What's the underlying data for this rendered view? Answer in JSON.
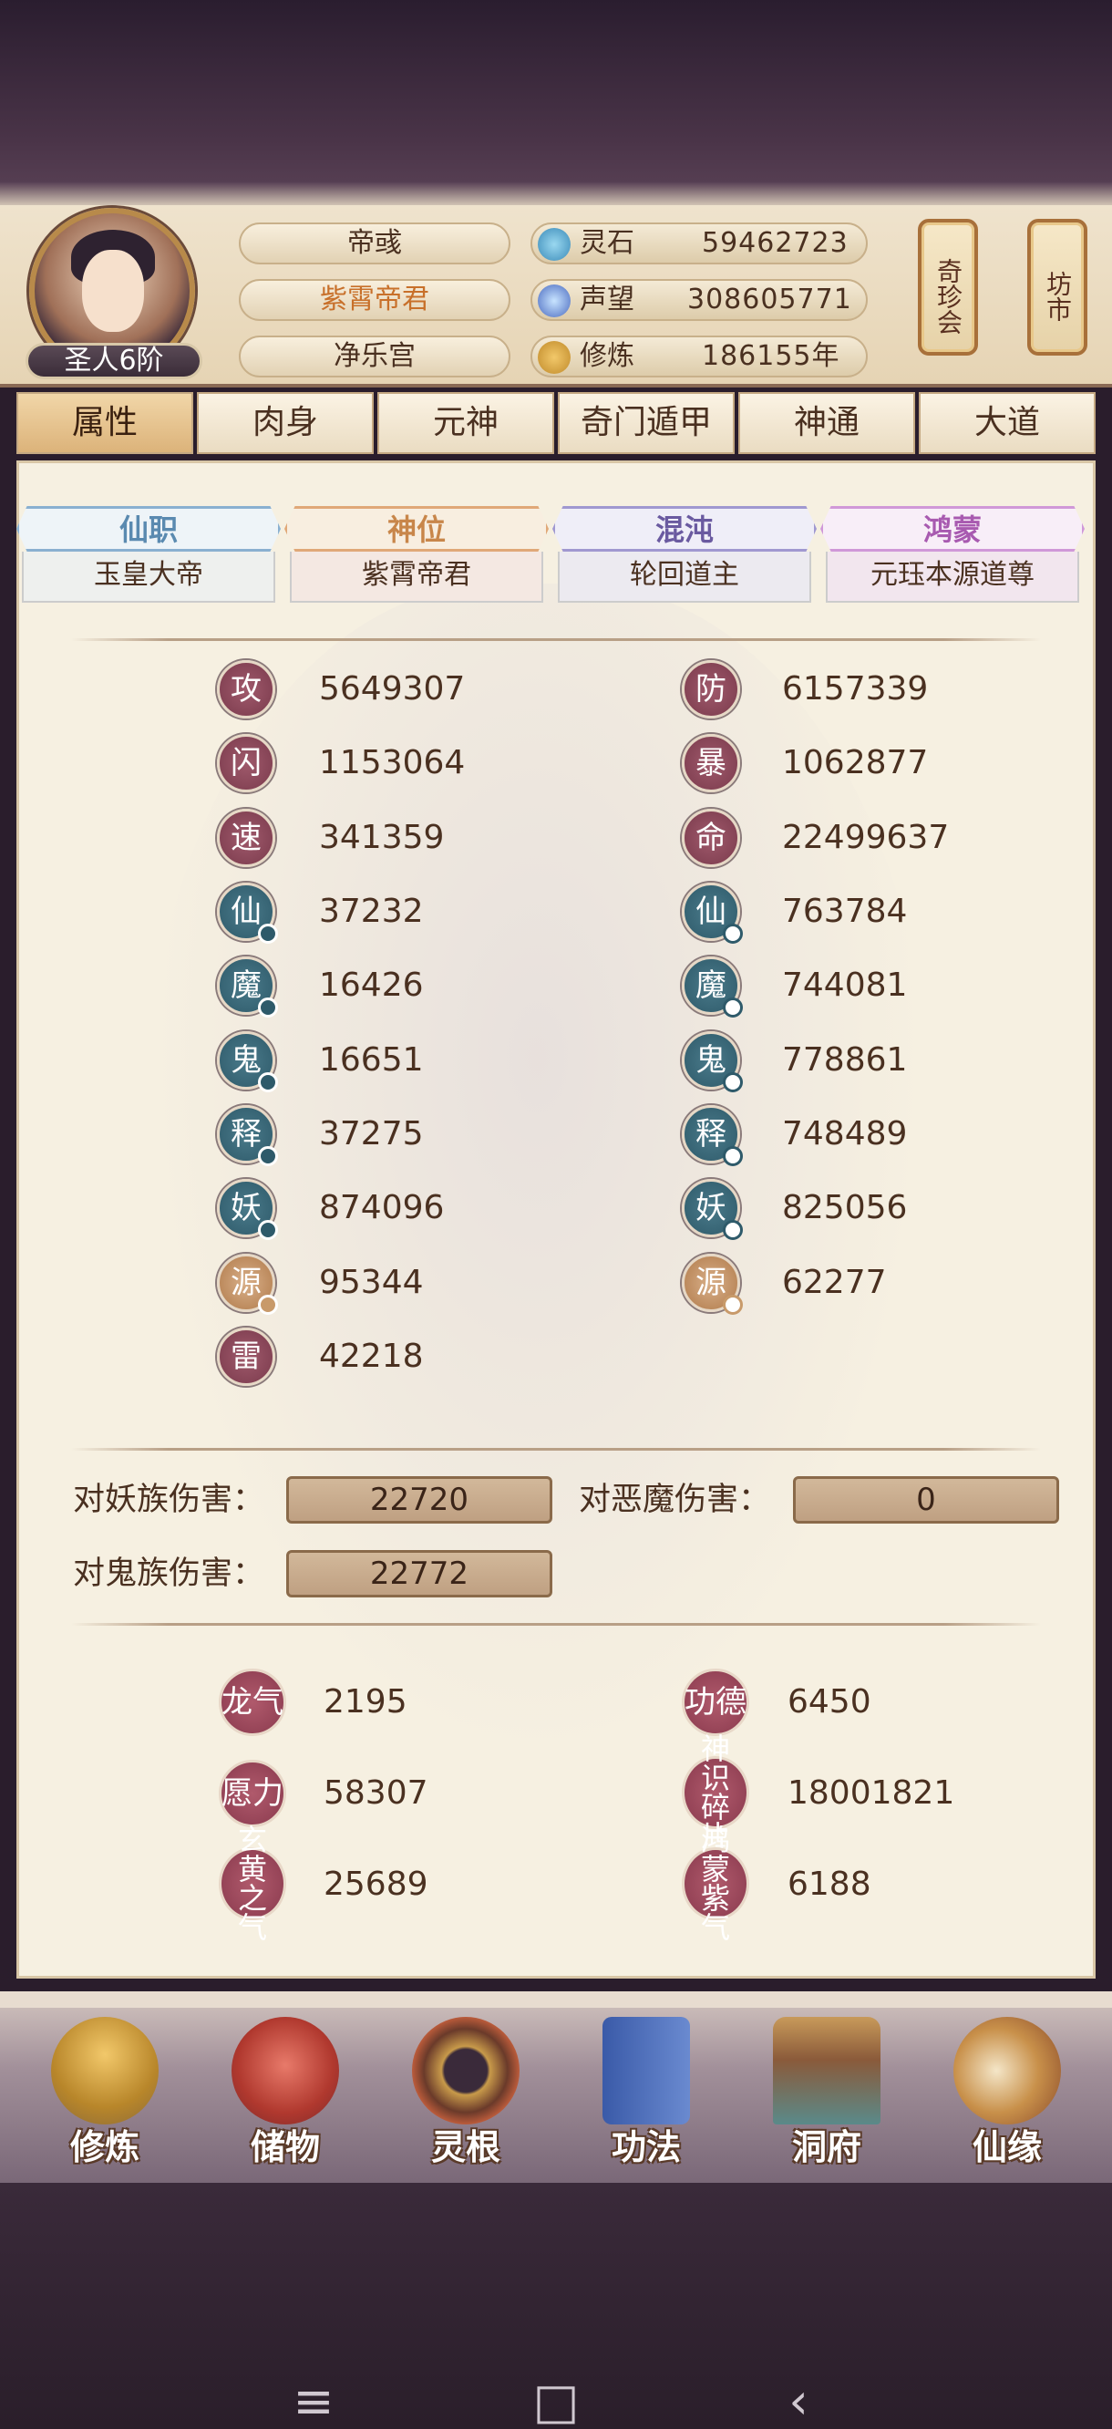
{
  "header": {
    "player_name": "帝彧",
    "title": "紫霄帝君",
    "palace": "净乐宫",
    "rank": "圣人6阶",
    "resources": [
      {
        "icon": "spirit-stone-icon",
        "label": "灵石",
        "value": "59462723"
      },
      {
        "icon": "reputation-icon",
        "label": "声望",
        "value": "308605771"
      },
      {
        "icon": "cultivation-icon",
        "label": "修炼",
        "value": "186155年"
      }
    ],
    "shortcuts": [
      {
        "label": "奇珍会"
      },
      {
        "label": "坊市"
      }
    ]
  },
  "tabs": [
    "属性",
    "肉身",
    "元神",
    "奇门遁甲",
    "神通",
    "大道"
  ],
  "ranks": [
    {
      "header": "仙职",
      "value": "玉皇大帝",
      "color": "#5a8ab0"
    },
    {
      "header": "神位",
      "value": "紫霄帝君",
      "color": "#c8864a"
    },
    {
      "header": "混沌",
      "value": "轮回道主",
      "color": "#6a5aa0"
    },
    {
      "header": "鸿蒙",
      "value": "元珏本源道尊",
      "color": "#a85ab0"
    }
  ],
  "stats_left": [
    {
      "char": "攻",
      "value": "5649307",
      "style": "red"
    },
    {
      "char": "闪",
      "value": "1153064",
      "style": "red"
    },
    {
      "char": "速",
      "value": "341359",
      "style": "red"
    },
    {
      "char": "仙",
      "value": "37232",
      "style": "blue"
    },
    {
      "char": "魔",
      "value": "16426",
      "style": "blue"
    },
    {
      "char": "鬼",
      "value": "16651",
      "style": "blue"
    },
    {
      "char": "释",
      "value": "37275",
      "style": "blue"
    },
    {
      "char": "妖",
      "value": "874096",
      "style": "blue"
    },
    {
      "char": "源",
      "value": "95344",
      "style": "gold"
    },
    {
      "char": "雷",
      "value": "42218",
      "style": "red"
    }
  ],
  "stats_right": [
    {
      "char": "防",
      "value": "6157339",
      "style": "red"
    },
    {
      "char": "暴",
      "value": "1062877",
      "style": "red"
    },
    {
      "char": "命",
      "value": "22499637",
      "style": "red"
    },
    {
      "char": "仙",
      "value": "763784",
      "style": "blue"
    },
    {
      "char": "魔",
      "value": "744081",
      "style": "blue"
    },
    {
      "char": "鬼",
      "value": "778861",
      "style": "blue"
    },
    {
      "char": "释",
      "value": "748489",
      "style": "blue"
    },
    {
      "char": "妖",
      "value": "825056",
      "style": "blue"
    },
    {
      "char": "源",
      "value": "62277",
      "style": "gold"
    }
  ],
  "damage": {
    "yao_label": "对妖族伤害：",
    "yao_value": "22720",
    "demon_label": "对恶魔伤害：",
    "demon_value": "0",
    "ghost_label": "对鬼族伤害：",
    "ghost_value": "22772"
  },
  "extras": [
    {
      "badge": "龙气",
      "value": "2195"
    },
    {
      "badge": "功德",
      "value": "6450"
    },
    {
      "badge": "愿力",
      "value": "58307"
    },
    {
      "badge": "神识碎片",
      "value": "18001821"
    },
    {
      "badge": "玄黄之气",
      "value": "25689"
    },
    {
      "badge": "鸿蒙紫气",
      "value": "6188"
    }
  ],
  "bottom_nav": [
    {
      "label": "修炼",
      "icon": "cultivate-icon"
    },
    {
      "label": "储物",
      "icon": "storage-bag-icon"
    },
    {
      "label": "灵根",
      "icon": "spirit-root-icon"
    },
    {
      "label": "功法",
      "icon": "technique-book-icon"
    },
    {
      "label": "洞府",
      "icon": "cave-dwelling-icon"
    },
    {
      "label": "仙缘",
      "icon": "immortal-fate-icon"
    }
  ],
  "system_nav": [
    "≡",
    "□",
    "‹"
  ]
}
